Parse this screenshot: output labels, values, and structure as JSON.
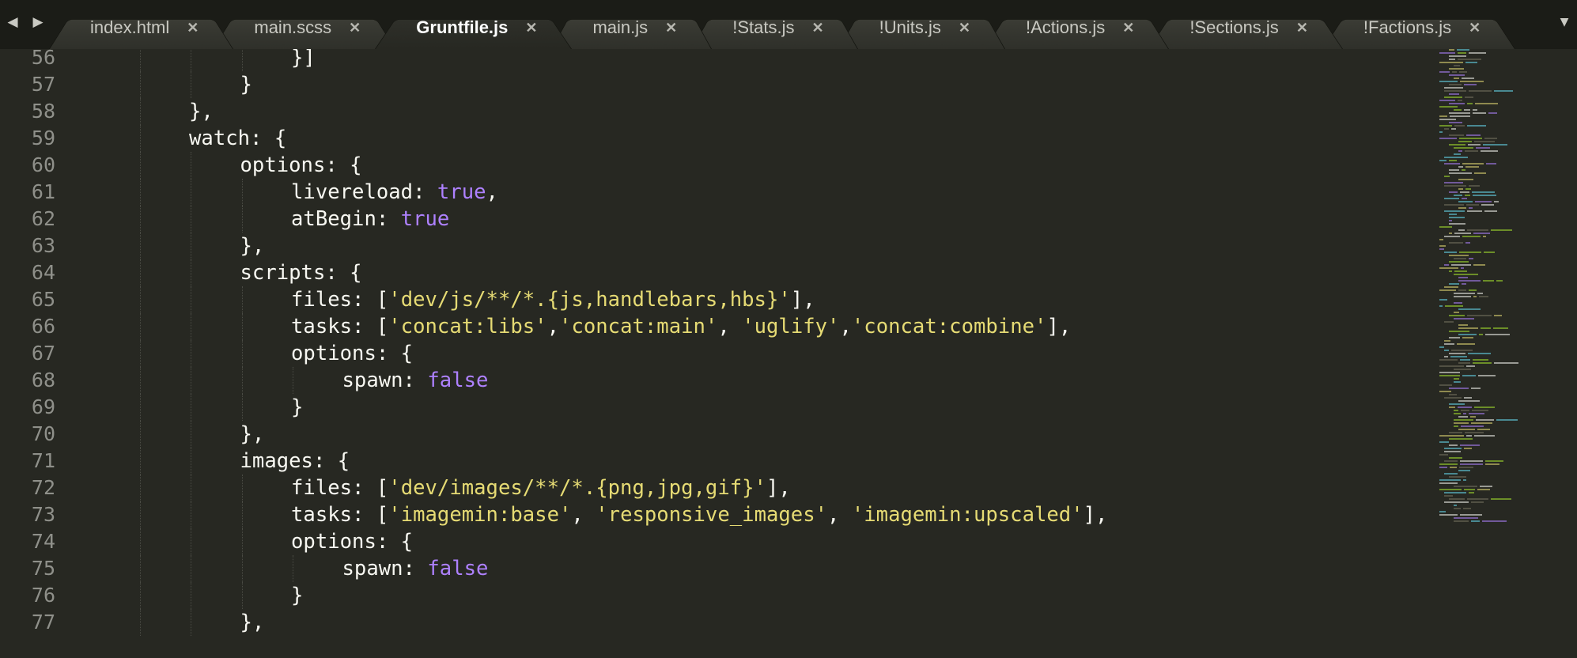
{
  "tabs": [
    {
      "label": "index.html"
    },
    {
      "label": "main.scss"
    },
    {
      "label": "Gruntfile.js",
      "active": true
    },
    {
      "label": "main.js"
    },
    {
      "label": "!Stats.js"
    },
    {
      "label": "!Units.js"
    },
    {
      "label": "!Actions.js"
    },
    {
      "label": "!Sections.js"
    },
    {
      "label": "!Factions.js"
    }
  ],
  "tab_close_glyph": "✕",
  "nav": {
    "back_glyph": "◀",
    "forward_glyph": "▶",
    "menu_glyph": "▼"
  },
  "lines": [
    {
      "n": "56",
      "indent": 4,
      "tokens": [
        {
          "t": "}]"
        }
      ]
    },
    {
      "n": "57",
      "indent": 3,
      "tokens": [
        {
          "t": "}"
        }
      ]
    },
    {
      "n": "58",
      "indent": 2,
      "tokens": [
        {
          "t": "},"
        }
      ]
    },
    {
      "n": "59",
      "indent": 2,
      "tokens": [
        {
          "t": "watch: {"
        }
      ]
    },
    {
      "n": "60",
      "indent": 3,
      "tokens": [
        {
          "t": "options: {"
        }
      ]
    },
    {
      "n": "61",
      "indent": 4,
      "tokens": [
        {
          "t": "livereload: "
        },
        {
          "t": "true",
          "c": "const"
        },
        {
          "t": ","
        }
      ]
    },
    {
      "n": "62",
      "indent": 4,
      "tokens": [
        {
          "t": "atBegin: "
        },
        {
          "t": "true",
          "c": "const"
        }
      ]
    },
    {
      "n": "63",
      "indent": 3,
      "tokens": [
        {
          "t": "},"
        }
      ]
    },
    {
      "n": "64",
      "indent": 3,
      "tokens": [
        {
          "t": "scripts: {"
        }
      ]
    },
    {
      "n": "65",
      "indent": 4,
      "tokens": [
        {
          "t": "files: ["
        },
        {
          "t": "'dev/js/**/*.{js,handlebars,hbs}'",
          "c": "str"
        },
        {
          "t": "],"
        }
      ]
    },
    {
      "n": "66",
      "indent": 4,
      "tokens": [
        {
          "t": "tasks: ["
        },
        {
          "t": "'concat:libs'",
          "c": "str"
        },
        {
          "t": ","
        },
        {
          "t": "'concat:main'",
          "c": "str"
        },
        {
          "t": ", "
        },
        {
          "t": "'uglify'",
          "c": "str"
        },
        {
          "t": ","
        },
        {
          "t": "'concat:combine'",
          "c": "str"
        },
        {
          "t": "],"
        }
      ]
    },
    {
      "n": "67",
      "indent": 4,
      "tokens": [
        {
          "t": "options: {"
        }
      ]
    },
    {
      "n": "68",
      "indent": 5,
      "tokens": [
        {
          "t": "spawn: "
        },
        {
          "t": "false",
          "c": "const"
        }
      ]
    },
    {
      "n": "69",
      "indent": 4,
      "tokens": [
        {
          "t": "}"
        }
      ]
    },
    {
      "n": "70",
      "indent": 3,
      "tokens": [
        {
          "t": "},"
        }
      ]
    },
    {
      "n": "71",
      "indent": 3,
      "tokens": [
        {
          "t": "images: {"
        }
      ]
    },
    {
      "n": "72",
      "indent": 4,
      "tokens": [
        {
          "t": "files: ["
        },
        {
          "t": "'dev/images/**/*.{png,jpg,gif}'",
          "c": "str"
        },
        {
          "t": "],"
        }
      ]
    },
    {
      "n": "73",
      "indent": 4,
      "tokens": [
        {
          "t": "tasks: ["
        },
        {
          "t": "'imagemin:base'",
          "c": "str"
        },
        {
          "t": ", "
        },
        {
          "t": "'responsive_images'",
          "c": "str"
        },
        {
          "t": ", "
        },
        {
          "t": "'imagemin:upscaled'",
          "c": "str"
        },
        {
          "t": "],"
        }
      ]
    },
    {
      "n": "74",
      "indent": 4,
      "tokens": [
        {
          "t": "options: {"
        }
      ]
    },
    {
      "n": "75",
      "indent": 5,
      "tokens": [
        {
          "t": "spawn: "
        },
        {
          "t": "false",
          "c": "const"
        }
      ]
    },
    {
      "n": "76",
      "indent": 4,
      "tokens": [
        {
          "t": "}"
        }
      ]
    },
    {
      "n": "77",
      "indent": 3,
      "tokens": [
        {
          "t": "},"
        }
      ]
    }
  ],
  "theme": {
    "background": "#272822",
    "foreground": "#f8f8f2",
    "string": "#e6db74",
    "constant": "#ae81ff",
    "line_number": "#8f908a"
  }
}
